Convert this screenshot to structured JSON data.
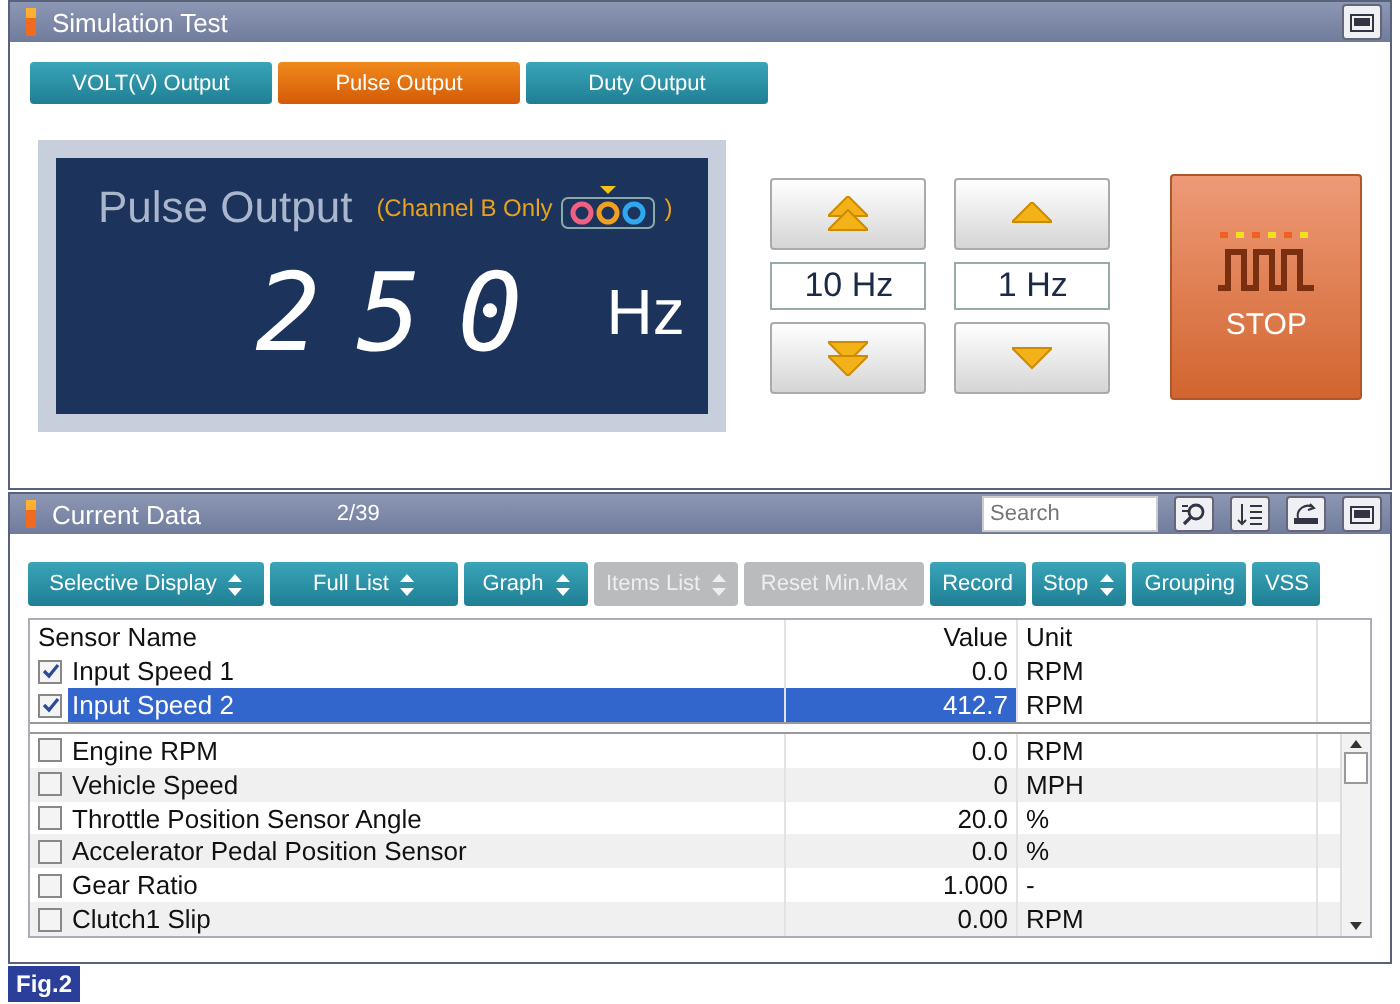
{
  "simulation": {
    "title": "Simulation Test",
    "tabs": [
      {
        "label": "VOLT(V) Output",
        "selected": false
      },
      {
        "label": "Pulse Output",
        "selected": true
      },
      {
        "label": "Duty Output",
        "selected": false
      }
    ],
    "display": {
      "title": "Pulse Output",
      "note_open": "(Channel B Only",
      "note_close": ")",
      "value": "250",
      "unit": "Hz"
    },
    "steps": [
      {
        "label": "10 Hz",
        "kind": "double"
      },
      {
        "label": "1 Hz",
        "kind": "single"
      }
    ],
    "stop_label": "STOP"
  },
  "current_data": {
    "title": "Current Data",
    "count": "2/39",
    "search": {
      "placeholder": "Search"
    },
    "toolbar": [
      {
        "label": "Selective Display",
        "kind": "dropdown",
        "disabled": false
      },
      {
        "label": "Full List",
        "kind": "dropdown",
        "disabled": false
      },
      {
        "label": "Graph",
        "kind": "dropdown",
        "disabled": false
      },
      {
        "label": "Items List",
        "kind": "dropdown",
        "disabled": true
      },
      {
        "label": "Reset Min.Max",
        "kind": "plain",
        "disabled": true
      },
      {
        "label": "Record",
        "kind": "plain",
        "disabled": false
      },
      {
        "label": "Stop",
        "kind": "dropdown",
        "disabled": false
      },
      {
        "label": "Grouping",
        "kind": "plain",
        "disabled": false
      },
      {
        "label": "VSS",
        "kind": "plain",
        "disabled": false
      }
    ],
    "columns": [
      "Sensor Name",
      "Value",
      "Unit"
    ],
    "pinned_rows": [
      {
        "name": "Input Speed 1",
        "value": "0.0",
        "unit": "RPM",
        "checked": true,
        "selected": false
      },
      {
        "name": "Input Speed 2",
        "value": "412.7",
        "unit": "RPM",
        "checked": true,
        "selected": true
      }
    ],
    "rows": [
      {
        "name": "Engine RPM",
        "value": "0.0",
        "unit": "RPM",
        "checked": false,
        "selected": false
      },
      {
        "name": "Vehicle Speed",
        "value": "0",
        "unit": "MPH",
        "checked": false,
        "selected": false
      },
      {
        "name": "Throttle Position Sensor Angle",
        "value": "20.0",
        "unit": "%",
        "checked": false,
        "selected": false
      },
      {
        "name": "Accelerator Pedal Position Sensor",
        "value": "0.0",
        "unit": "%",
        "checked": false,
        "selected": false
      },
      {
        "name": "Gear Ratio",
        "value": "1.000",
        "unit": "-",
        "checked": false,
        "selected": false
      },
      {
        "name": "Clutch1 Slip",
        "value": "0.00",
        "unit": "RPM",
        "checked": false,
        "selected": false
      }
    ]
  },
  "figure_label": "Fig.2"
}
